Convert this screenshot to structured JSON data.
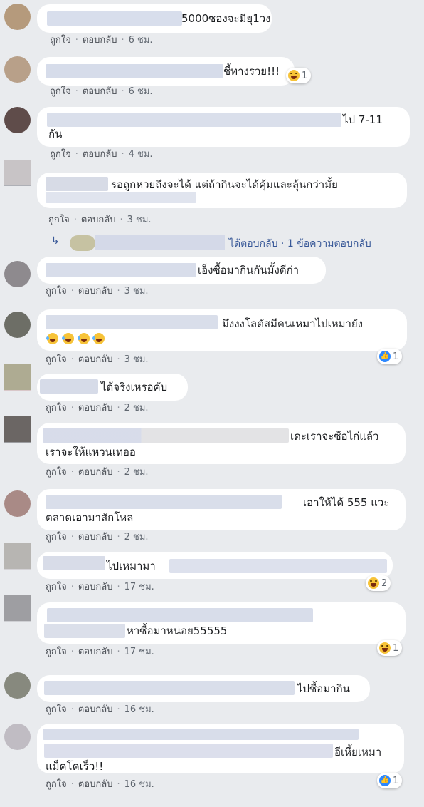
{
  "actions": {
    "like": "ถูกใจ",
    "reply": "ตอบกลับ",
    "sep": "·"
  },
  "colors": {
    "background": "#e9ebee",
    "bubble": "#ffffff",
    "link": "#385898",
    "meta": "#606770",
    "haha": "#f7c338",
    "like": "#2d88ff"
  },
  "comments": [
    {
      "text": "5000ซองจะมียุ1วง",
      "time": "6 ชม."
    },
    {
      "text": "ชี้ทางรวย!!!",
      "time": "6 ชม.",
      "reaction": {
        "icon": "haha-icon",
        "count": "1"
      }
    },
    {
      "line1": "ไป 7-11",
      "line2": "กัน",
      "time": "4 ชม."
    },
    {
      "text": "รอถูกหวยถึงจะได้ แต่ถ้ากินจะได้คุ้มและลุ้นกว่ามั้ย",
      "time": "3 ชม."
    },
    {
      "text": "เอ็งซื้อมากินกันมั้งดีก่า",
      "time": "3 ชม."
    },
    {
      "text": "มึงงงโลตัสมีคนเหมาไปเหมายัง",
      "emoji_count": 4,
      "emoji_icon": "laughing-tears-icon",
      "time": "3 ชม.",
      "reaction": {
        "icon": "like-icon",
        "count": "1"
      }
    },
    {
      "text": "ได้จริงเหรอคับ",
      "time": "2 ชม."
    },
    {
      "line1": "เดะเราจะซ้อไก่แล้ว",
      "line2": "เราจะให้แหวนเทออ",
      "time": "2 ชม."
    },
    {
      "line1": "เอาให้ได้ 555 แวะ",
      "line2": "ตลาดเอามาสักโหล",
      "time": "2 ชม."
    },
    {
      "text": "ไปเหมามา",
      "time": "17 ชม.",
      "reaction": {
        "icon": "haha-icon",
        "count": "2"
      }
    },
    {
      "text": "หาซื้อมาหน่อย55555",
      "time": "17 ชม.",
      "reaction": {
        "icon": "haha-icon",
        "count": "1"
      }
    },
    {
      "text": "ไปซื้อมากิน",
      "time": "16 ชม."
    },
    {
      "line1": "อีเหี้ยเหมา",
      "line2": "แม็คโคเร็ว!!",
      "time": "16 ชม.",
      "reaction": {
        "icon": "like-icon",
        "count": "1"
      }
    }
  ],
  "reply_summary": {
    "text": "ได้ตอบกลับ · 1 ข้อความตอบกลับ",
    "icon": "reply-arrow-icon"
  }
}
